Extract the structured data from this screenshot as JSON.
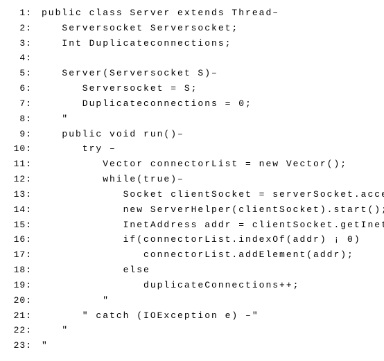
{
  "code": {
    "lines": [
      {
        "num": "1:",
        "indent": 0,
        "text": "public class Server extends Thread–"
      },
      {
        "num": "2:",
        "indent": 1,
        "text": "Serversocket Serversocket;"
      },
      {
        "num": "3:",
        "indent": 1,
        "text": "Int Duplicateconnections;"
      },
      {
        "num": "4:",
        "indent": 0,
        "text": ""
      },
      {
        "num": "5:",
        "indent": 1,
        "text": "Server(Serversocket S)–"
      },
      {
        "num": "6:",
        "indent": 2,
        "text": "Serversocket = S;"
      },
      {
        "num": "7:",
        "indent": 2,
        "text": "Duplicateconnections = 0;"
      },
      {
        "num": "8:",
        "indent": 1,
        "text": "ʺ"
      },
      {
        "num": "9:",
        "indent": 1,
        "text": "public void run()–"
      },
      {
        "num": "10:",
        "indent": 2,
        "text": "try –"
      },
      {
        "num": "11:",
        "indent": 3,
        "text": "Vector connectorList = new Vector();"
      },
      {
        "num": "12:",
        "indent": 3,
        "text": "while(true)–"
      },
      {
        "num": "13:",
        "indent": 4,
        "text": "Socket clientSocket = serverSocket.accept();"
      },
      {
        "num": "14:",
        "indent": 4,
        "text": "new ServerHelper(clientSocket).start();"
      },
      {
        "num": "15:",
        "indent": 4,
        "text": "InetAddress addr = clientSocket.getInetAddress();"
      },
      {
        "num": "16:",
        "indent": 4,
        "text": "if(connectorList.indexOf(addr) ¡ 0)"
      },
      {
        "num": "17:",
        "indent": 5,
        "text": "connectorList.addElement(addr);"
      },
      {
        "num": "18:",
        "indent": 4,
        "text": "else"
      },
      {
        "num": "19:",
        "indent": 5,
        "text": "duplicateConnections++;"
      },
      {
        "num": "20:",
        "indent": 3,
        "text": "ʺ"
      },
      {
        "num": "21:",
        "indent": 2,
        "text": "ʺ catch (IOException e) –ʺ"
      },
      {
        "num": "22:",
        "indent": 1,
        "text": "ʺ"
      },
      {
        "num": "23:",
        "indent": 0,
        "text": "ʺ"
      }
    ],
    "indent_unit": "   "
  }
}
